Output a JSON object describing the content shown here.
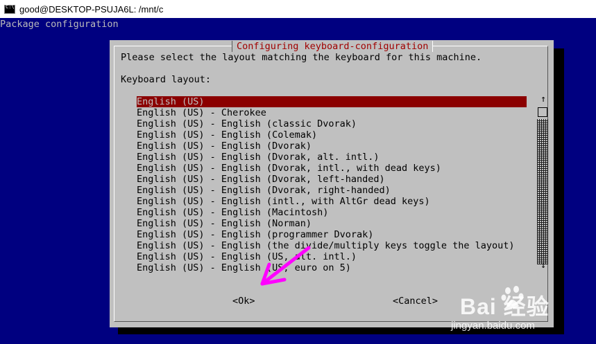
{
  "window": {
    "title": "good@DESKTOP-PSUJA6L: /mnt/c"
  },
  "screen": {
    "header": "Package configuration"
  },
  "dialog": {
    "title": "Configuring keyboard-configuration",
    "prompt": "Please select the layout matching the keyboard for this machine.",
    "field_label": "Keyboard layout:",
    "items": [
      "English (US)",
      "English (US) - Cherokee",
      "English (US) - English (classic Dvorak)",
      "English (US) - English (Colemak)",
      "English (US) - English (Dvorak)",
      "English (US) - English (Dvorak, alt. intl.)",
      "English (US) - English (Dvorak, intl., with dead keys)",
      "English (US) - English (Dvorak, left-handed)",
      "English (US) - English (Dvorak, right-handed)",
      "English (US) - English (intl., with AltGr dead keys)",
      "English (US) - English (Macintosh)",
      "English (US) - English (Norman)",
      "English (US) - English (programmer Dvorak)",
      "English (US) - English (the divide/multiply keys toggle the layout)",
      "English (US) - English (US, alt. intl.)",
      "English (US) - English (US, euro on 5)"
    ],
    "selected_index": 0,
    "ok_label": "<Ok>",
    "cancel_label": "<Cancel>",
    "scroll_up": "↑",
    "scroll_down": "↓"
  },
  "watermark": {
    "brand": "Bai  经验",
    "url": "jingyan.baidu.com"
  },
  "colors": {
    "terminal_bg": "#000080",
    "dialog_bg": "#c0c0c0",
    "selection": "#8b0000",
    "title_text": "#a00000",
    "annotation_arrow": "#ff00ff"
  }
}
